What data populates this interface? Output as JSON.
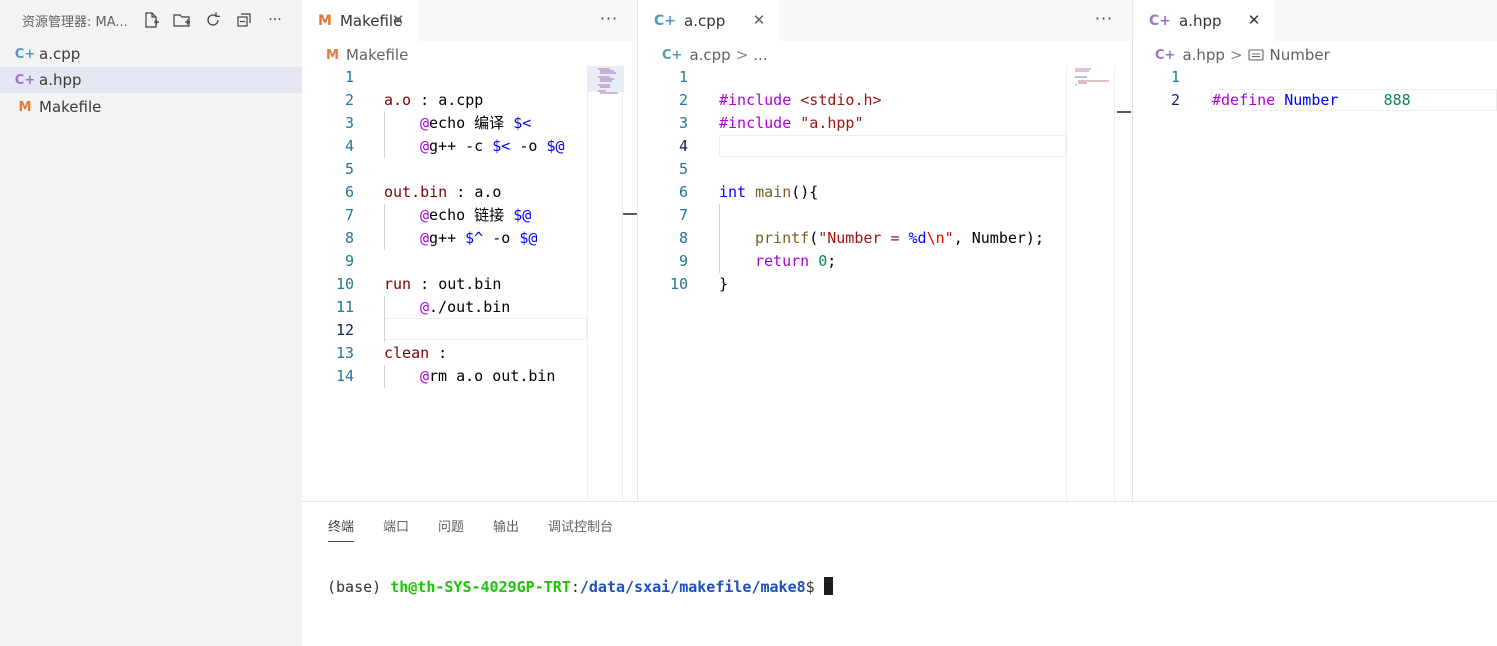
{
  "explorer": {
    "title": "资源管理器: MA...",
    "actions": [
      "new-file-icon",
      "new-folder-icon",
      "refresh-icon",
      "collapse-all-icon",
      "more-icon"
    ],
    "more_label": "···",
    "files": [
      {
        "name": "a.cpp",
        "icon": "cpp-file-icon",
        "glyph": "C+"
      },
      {
        "name": "a.hpp",
        "icon": "hpp-file-icon",
        "glyph": "C+",
        "selected": true
      },
      {
        "name": "Makefile",
        "icon": "makefile-icon",
        "glyph": "M"
      }
    ]
  },
  "editors": {
    "makefile": {
      "tab": {
        "label": "Makefile",
        "glyph": "M",
        "close": "✕"
      },
      "more": "···",
      "breadcrumb": {
        "file": "Makefile",
        "glyph": "M"
      },
      "current_line": 12,
      "lines": [
        {
          "n": "1"
        },
        {
          "n": "2"
        },
        {
          "n": "3"
        },
        {
          "n": "4"
        },
        {
          "n": "5"
        },
        {
          "n": "6"
        },
        {
          "n": "7"
        },
        {
          "n": "8"
        },
        {
          "n": "9"
        },
        {
          "n": "10"
        },
        {
          "n": "11"
        },
        {
          "n": "12"
        },
        {
          "n": "13"
        },
        {
          "n": "14"
        }
      ],
      "code": {
        "l2": {
          "target": "a.o",
          "sep": " : ",
          "dep": "a.cpp"
        },
        "l3": {
          "at": "@",
          "cmd": "echo 编译 ",
          "var": "$<"
        },
        "l4": {
          "at": "@",
          "cmd": "g++ -c ",
          "var1": "$<",
          "mid": " -o ",
          "var2": "$@"
        },
        "l6": {
          "target": "out.bin",
          "sep": " : ",
          "dep": "a.o"
        },
        "l7": {
          "at": "@",
          "cmd": "echo 链接 ",
          "var": "$@"
        },
        "l8": {
          "at": "@",
          "cmd": "g++ ",
          "var1": "$^",
          "mid": " -o ",
          "var2": "$@"
        },
        "l10": {
          "target": "run",
          "sep": " : ",
          "dep": "out.bin"
        },
        "l11": {
          "at": "@",
          "cmd": "./out.bin"
        },
        "l13": {
          "target": "clean",
          "sep": " :"
        },
        "l14": {
          "at": "@",
          "cmd": "rm a.o out.bin"
        }
      }
    },
    "acpp": {
      "tab": {
        "label": "a.cpp",
        "glyph": "C+",
        "close": "✕"
      },
      "more": "···",
      "breadcrumb": {
        "file": "a.cpp",
        "sep": ">",
        "rest": "..."
      },
      "current_line": 4,
      "lines": [
        {
          "n": "1"
        },
        {
          "n": "2"
        },
        {
          "n": "3"
        },
        {
          "n": "4"
        },
        {
          "n": "5"
        },
        {
          "n": "6"
        },
        {
          "n": "7"
        },
        {
          "n": "8"
        },
        {
          "n": "9"
        },
        {
          "n": "10"
        }
      ],
      "code": {
        "l2": {
          "pre": "#include ",
          "inc": "<stdio.h>"
        },
        "l3": {
          "pre": "#include ",
          "inc": "\"a.hpp\""
        },
        "l6": {
          "kw": "int",
          "rest": " ",
          "fn": "main",
          "tail": "(){"
        },
        "l8": {
          "fn": "printf",
          "p1": "(",
          "s1": "\"Number = ",
          "fmt": "%d",
          "esc": "\\n",
          "s2": "\"",
          "tail": ", Number);"
        },
        "l9": {
          "ctl": "return",
          "sp": " ",
          "num": "0",
          "tail": ";"
        },
        "l10": {
          "tail": "}"
        }
      }
    },
    "ahpp": {
      "tab": {
        "label": "a.hpp",
        "glyph": "C+",
        "close": "✕"
      },
      "breadcrumb": {
        "file": "a.hpp",
        "sep": ">",
        "symbol": "Number",
        "symbol_icon": "symbol-constant-icon"
      },
      "current_line": 2,
      "lines": [
        {
          "n": "1"
        },
        {
          "n": "2"
        }
      ],
      "code": {
        "l2": {
          "pre": "#define ",
          "mac": "Number",
          "gap": "     ",
          "num": "888"
        }
      }
    }
  },
  "panel": {
    "tabs": [
      {
        "label": "终端",
        "active": true
      },
      {
        "label": "端口"
      },
      {
        "label": "问题"
      },
      {
        "label": "输出"
      },
      {
        "label": "调试控制台"
      }
    ],
    "terminal": {
      "env": "(base) ",
      "user": "th@th-SYS-4029GP-TRT",
      "colon": ":",
      "path": "/data/sxai/makefile/make8",
      "prompt": "$ "
    }
  }
}
